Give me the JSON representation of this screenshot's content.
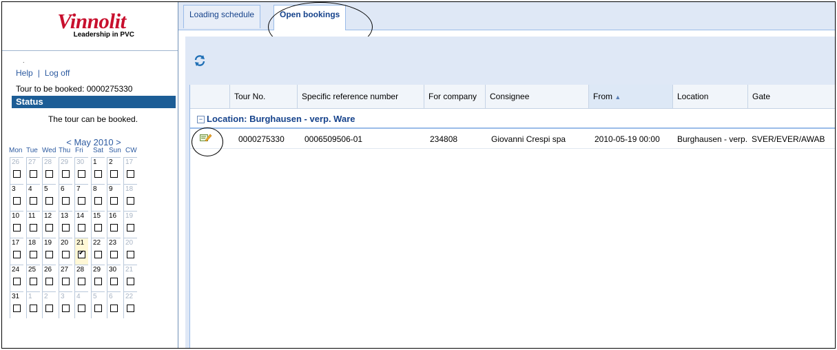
{
  "logo": {
    "title": "Vinnolit",
    "subtitle": "Leadership in PVC"
  },
  "sidebar": {
    "dot": ".",
    "help_label": "Help",
    "separator": "|",
    "logoff_label": "Log off",
    "tour_text": "Tour to be booked: 0000275330",
    "status_label": "Status",
    "status_text": "The tour can be booked.",
    "calendar": {
      "prev_label": "<",
      "month_label": "May 2010",
      "next_label": ">",
      "weekdays": [
        "Mon",
        "Tue",
        "Wed",
        "Thu",
        "Fri",
        "Sat",
        "Sun",
        "CW"
      ],
      "weeks": [
        [
          "26",
          "27",
          "28",
          "29",
          "30",
          "1",
          "2",
          "17"
        ],
        [
          "3",
          "4",
          "5",
          "6",
          "7",
          "8",
          "9",
          "18"
        ],
        [
          "10",
          "11",
          "12",
          "13",
          "14",
          "15",
          "16",
          "19"
        ],
        [
          "17",
          "18",
          "19",
          "20",
          "21",
          "22",
          "23",
          "20"
        ],
        [
          "24",
          "25",
          "26",
          "27",
          "28",
          "29",
          "30",
          "21"
        ],
        [
          "31",
          "1",
          "2",
          "3",
          "4",
          "5",
          "6",
          "22"
        ]
      ],
      "checked_day": "21"
    }
  },
  "tabs": [
    {
      "label": "Loading schedule",
      "active": false
    },
    {
      "label": "Open bookings",
      "active": true
    }
  ],
  "toolbar": {
    "refresh_icon": "refresh-icon"
  },
  "grid": {
    "columns": [
      "",
      "Tour No.",
      "Specific reference number",
      "For company",
      "Consignee",
      "From",
      "Location",
      "Gate"
    ],
    "sort_indicator": "▲",
    "group": {
      "toggle": "−",
      "label": "Location: Burghausen - verp. Ware"
    },
    "rows": [
      {
        "tour_no": "0000275330",
        "reference": "0006509506-01",
        "company": "234808",
        "consignee": "Giovanni Crespi spa",
        "from": "2010-05-19 00:00",
        "location": "Burghausen - verp.",
        "gate": "SVER/EVER/AWAB"
      }
    ]
  },
  "colors": {
    "brand": "#c8102e",
    "status_bar": "#1c5d96",
    "link": "#2c5aa0",
    "tab_bg": "#dfe8f6",
    "header_text": "#15428b"
  }
}
